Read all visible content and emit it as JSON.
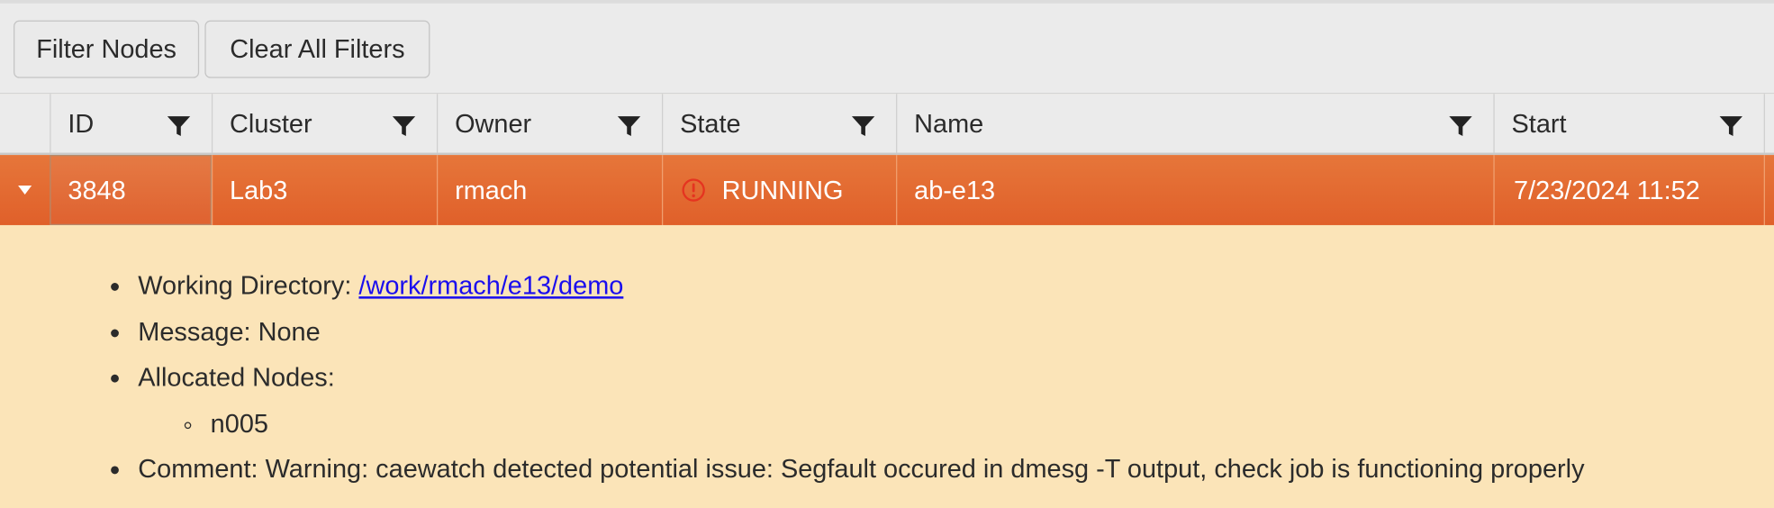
{
  "toolbar": {
    "filter_nodes_label": "Filter Nodes",
    "clear_filters_label": "Clear All Filters"
  },
  "table": {
    "columns": [
      {
        "label": "ID",
        "filter_icon": "filter-funnel-icon"
      },
      {
        "label": "Cluster",
        "filter_icon": "filter-funnel-icon"
      },
      {
        "label": "Owner",
        "filter_icon": "filter-funnel-icon"
      },
      {
        "label": "State",
        "filter_icon": "filter-funnel-icon"
      },
      {
        "label": "Name",
        "filter_icon": "filter-funnel-icon"
      },
      {
        "label": "Start",
        "filter_icon": "filter-funnel-icon"
      }
    ],
    "rows": [
      {
        "expanded": true,
        "expander_icon": "caret-down-icon",
        "id": "3848",
        "cluster": "Lab3",
        "owner": "rmach",
        "state": "RUNNING",
        "state_icon": "exclamation-circle-icon",
        "name": "ab-e13",
        "start": "7/23/2024 11:52"
      }
    ]
  },
  "detail": {
    "working_directory_label": "Working Directory: ",
    "working_directory": "/work/rmach/e13/demo",
    "message": "Message: None",
    "allocated_nodes_label": "Allocated Nodes:",
    "allocated_nodes": [
      "n005"
    ],
    "comment": "Comment: Warning: caewatch detected potential issue: Segfault occured in dmesg -T output, check job is functioning properly"
  },
  "colors": {
    "row_selected": "#e36a33",
    "detail_bg": "#fbe4b8",
    "state_icon": "#e53420",
    "link": "#1a0dee"
  }
}
